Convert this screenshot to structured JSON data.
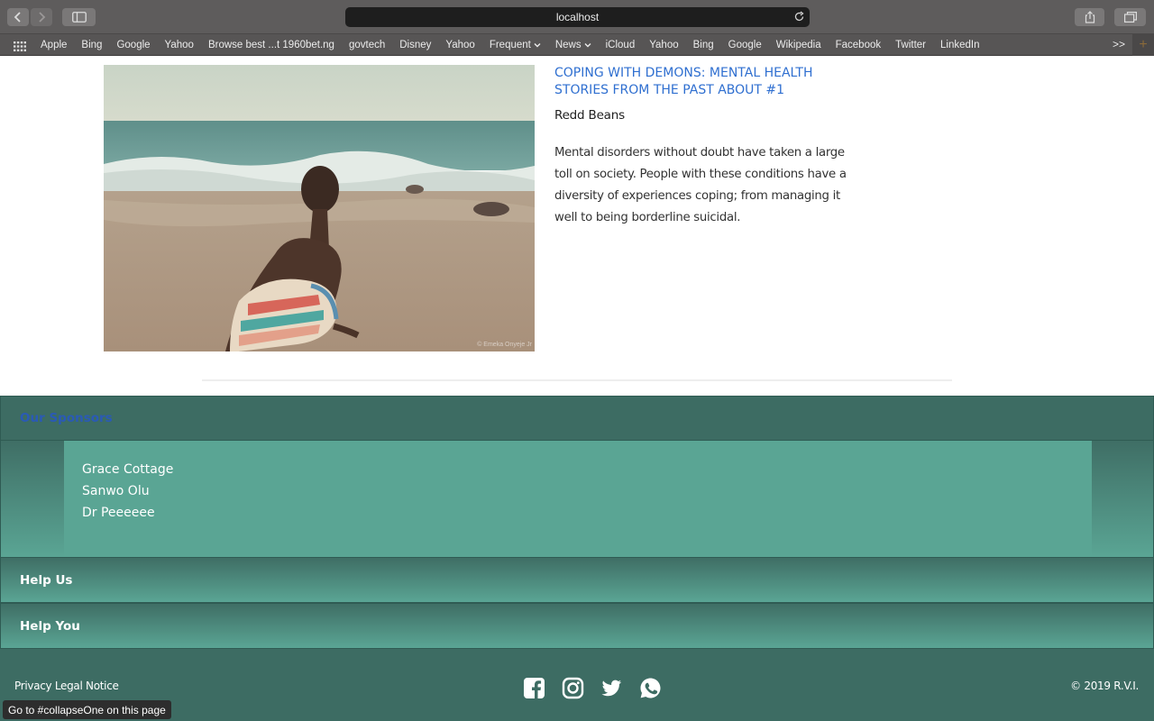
{
  "browser": {
    "url": "localhost",
    "bookmarks": [
      {
        "label": "Apple"
      },
      {
        "label": "Bing"
      },
      {
        "label": "Google"
      },
      {
        "label": "Yahoo"
      },
      {
        "label": "Browse best ...t 1960bet.ng"
      },
      {
        "label": "govtech"
      },
      {
        "label": "Disney"
      },
      {
        "label": "Yahoo"
      },
      {
        "label": "Frequent",
        "dropdown": true
      },
      {
        "label": "News",
        "dropdown": true
      },
      {
        "label": "iCloud"
      },
      {
        "label": "Yahoo"
      },
      {
        "label": "Bing"
      },
      {
        "label": "Google"
      },
      {
        "label": "Wikipedia"
      },
      {
        "label": "Facebook"
      },
      {
        "label": "Twitter"
      },
      {
        "label": "LinkedIn"
      }
    ],
    "more_label": ">>"
  },
  "article": {
    "title": "COPING WITH DEMONS: MENTAL HEALTH STORIES FROM THE PAST ABOUT #1",
    "author": "Redd Beans",
    "excerpt": "Mental disorders without doubt have taken a large toll on society. People with these conditions have a diversity of experiences coping; from managing it well to being borderline suicidal.",
    "image_credit": "© Emeka Onyeje Jr"
  },
  "accordion": {
    "sections": [
      {
        "title": "Our Sponsors",
        "open": true,
        "items": [
          "Grace Cottage",
          "Sanwo Olu",
          "Dr Peeeeee"
        ]
      },
      {
        "title": "Help Us",
        "open": false
      },
      {
        "title": "Help You",
        "open": false
      }
    ]
  },
  "footer": {
    "left_text": "Privacy Legal Notice",
    "right_text": "© 2019 R.V.I.",
    "social_icons": [
      "facebook-icon",
      "instagram-icon",
      "twitter-icon",
      "whatsapp-icon"
    ]
  },
  "status_bar": {
    "text": "Go to #collapseOne on this page"
  },
  "colors": {
    "accordion_dark": "#3d6c63",
    "accordion_light": "#5aa594",
    "link_blue": "#2f6fd0"
  }
}
